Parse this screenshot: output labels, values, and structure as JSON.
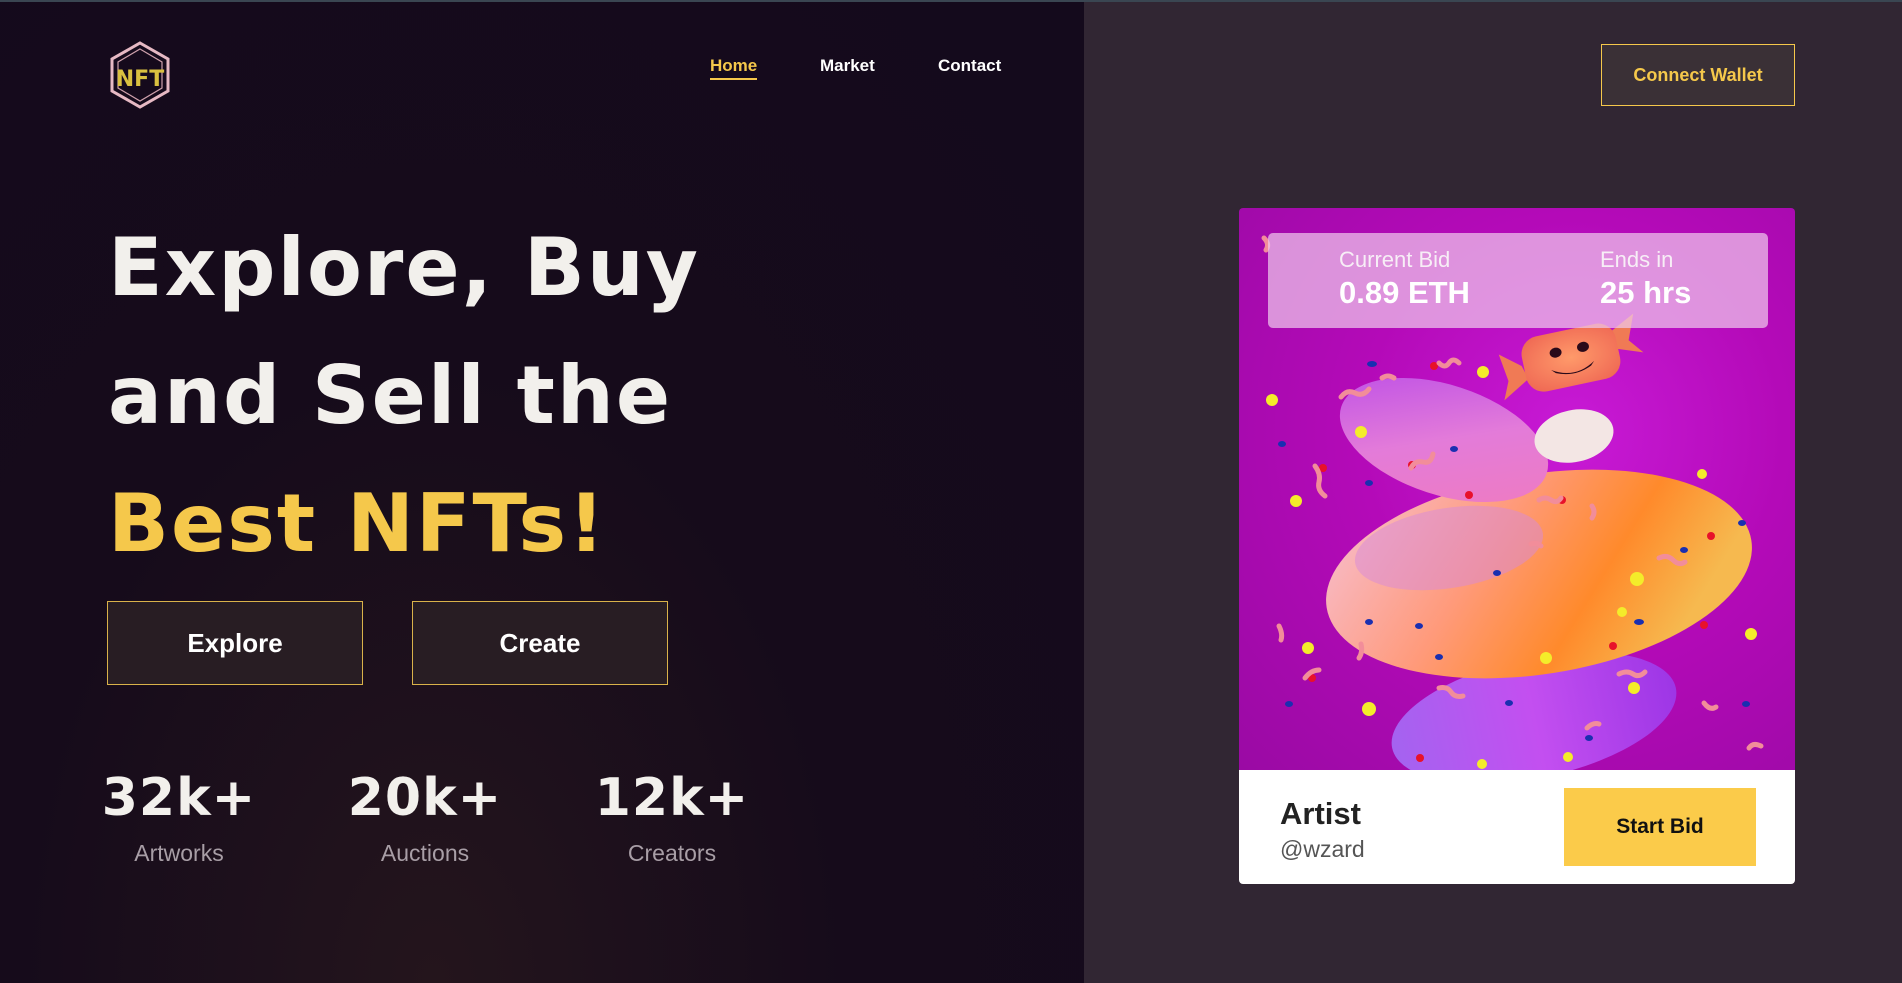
{
  "brand": {
    "logo_text": "NFT"
  },
  "nav": {
    "items": [
      {
        "label": "Home",
        "active": true
      },
      {
        "label": "Market",
        "active": false
      },
      {
        "label": "Contact",
        "active": false
      }
    ]
  },
  "header": {
    "connect_label": "Connect Wallet"
  },
  "hero": {
    "line1": "Explore, Buy",
    "line2": "and Sell the",
    "line3": "Best NFTs!",
    "explore_label": "Explore",
    "create_label": "Create"
  },
  "stats": [
    {
      "value": "32k+",
      "label": "Artworks"
    },
    {
      "value": "20k+",
      "label": "Auctions"
    },
    {
      "value": "12k+",
      "label": "Creators"
    }
  ],
  "card": {
    "current_bid_label": "Current Bid",
    "current_bid_value": "0.89 ETH",
    "ends_label": "Ends in",
    "ends_value": "25 hrs",
    "artist_title": "Artist",
    "artist_handle": "@wzard",
    "start_bid_label": "Start Bid"
  },
  "colors": {
    "accent": "#f5c84b",
    "left_bg": "#140a1c",
    "right_bg": "#312633",
    "card_bg": "#b40ab8"
  }
}
